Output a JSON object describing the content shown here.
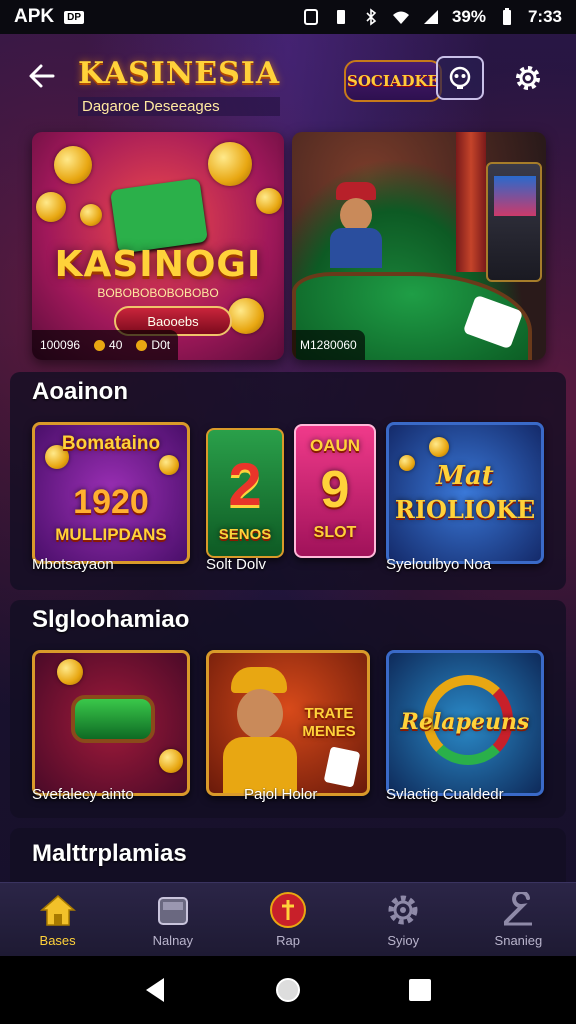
{
  "status_bar": {
    "carrier": "APK",
    "badge": "DP",
    "battery": "39%",
    "time": "7:33"
  },
  "header": {
    "logo_title": "KASINESIA",
    "logo_subtitle": "Dagaroe Deseeages",
    "brand_badge": "SOCIADKE"
  },
  "banners": [
    {
      "title": "KASINOGI",
      "subtitle": "BOBOBOBOBOBOBO",
      "cta": "Baooebs",
      "footer": [
        "100096",
        "40",
        "D0t"
      ]
    },
    {
      "footer": [
        "M1280060"
      ]
    }
  ],
  "sections": {
    "featured": {
      "title": "Aoainon",
      "cards": [
        {
          "label": "Mbotsayaon",
          "art_top": "Bomataino",
          "art_mid": "1920",
          "art_bottom": "MULLIPDANS"
        },
        {
          "label": "Solt Dolv",
          "art_mid": "2",
          "art_bottom": "SENOS"
        },
        {
          "label": "",
          "art_top": "OAUN",
          "art_mid": "9",
          "art_bottom": "SLOT"
        },
        {
          "label": "Syeloulbyo Noa",
          "art_top": "Mat",
          "art_mid": "RIOLIOKE"
        }
      ]
    },
    "second": {
      "title": "Slgloohamiao",
      "cards": [
        {
          "label": "Svefalecy ainto"
        },
        {
          "label": "Pajol Holor",
          "art_mid": "TRATE MENES"
        },
        {
          "label": "Svlactig Cualdedr",
          "art_mid": "Relapeuns"
        }
      ]
    },
    "third": {
      "title": "Malttrplamias"
    }
  },
  "bottom_nav": [
    {
      "label": "Bases",
      "icon": "home-icon",
      "active": true
    },
    {
      "label": "Nalnay",
      "icon": "wallet-icon",
      "active": false
    },
    {
      "label": "Rap",
      "icon": "cross-icon",
      "active": false
    },
    {
      "label": "Syioy",
      "icon": "gear-icon",
      "active": false
    },
    {
      "label": "Snanieg",
      "icon": "support-icon",
      "active": false
    }
  ],
  "colors": {
    "accent_gold": "#ffd23a",
    "background": "#1a1030",
    "nav_bg": "#2b2547"
  }
}
